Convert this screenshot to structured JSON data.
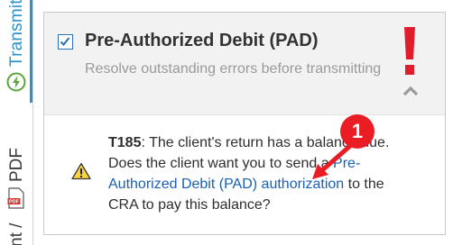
{
  "sidebar": {
    "tabs": [
      {
        "label": "Transmit",
        "icon": "lightning-icon",
        "active": true
      },
      {
        "label": "PDF",
        "icon": "pdf-file-icon",
        "active": false
      },
      {
        "label": "nt /",
        "active": false
      }
    ]
  },
  "card": {
    "checked": true,
    "title": "Pre-Authorized Debit (PAD)",
    "subtitle": "Resolve outstanding errors before transmitting",
    "alert_icon": "exclamation-icon",
    "chevron_icon": "chevron-up-icon",
    "message": {
      "code": "T185",
      "text_before_link": ": The client's return has a balance due. Does the client want you to send a ",
      "link": "Pre-Authorized Debit (PAD) authorization",
      "text_after_link": " to the CRA to pay this balance?",
      "icon": "warning-icon"
    }
  },
  "callout": {
    "number": "1"
  },
  "colors": {
    "accent": "#2a93c9",
    "alert": "#e11d2b",
    "link": "#1a5fb4",
    "callout": "#ea1c24"
  }
}
